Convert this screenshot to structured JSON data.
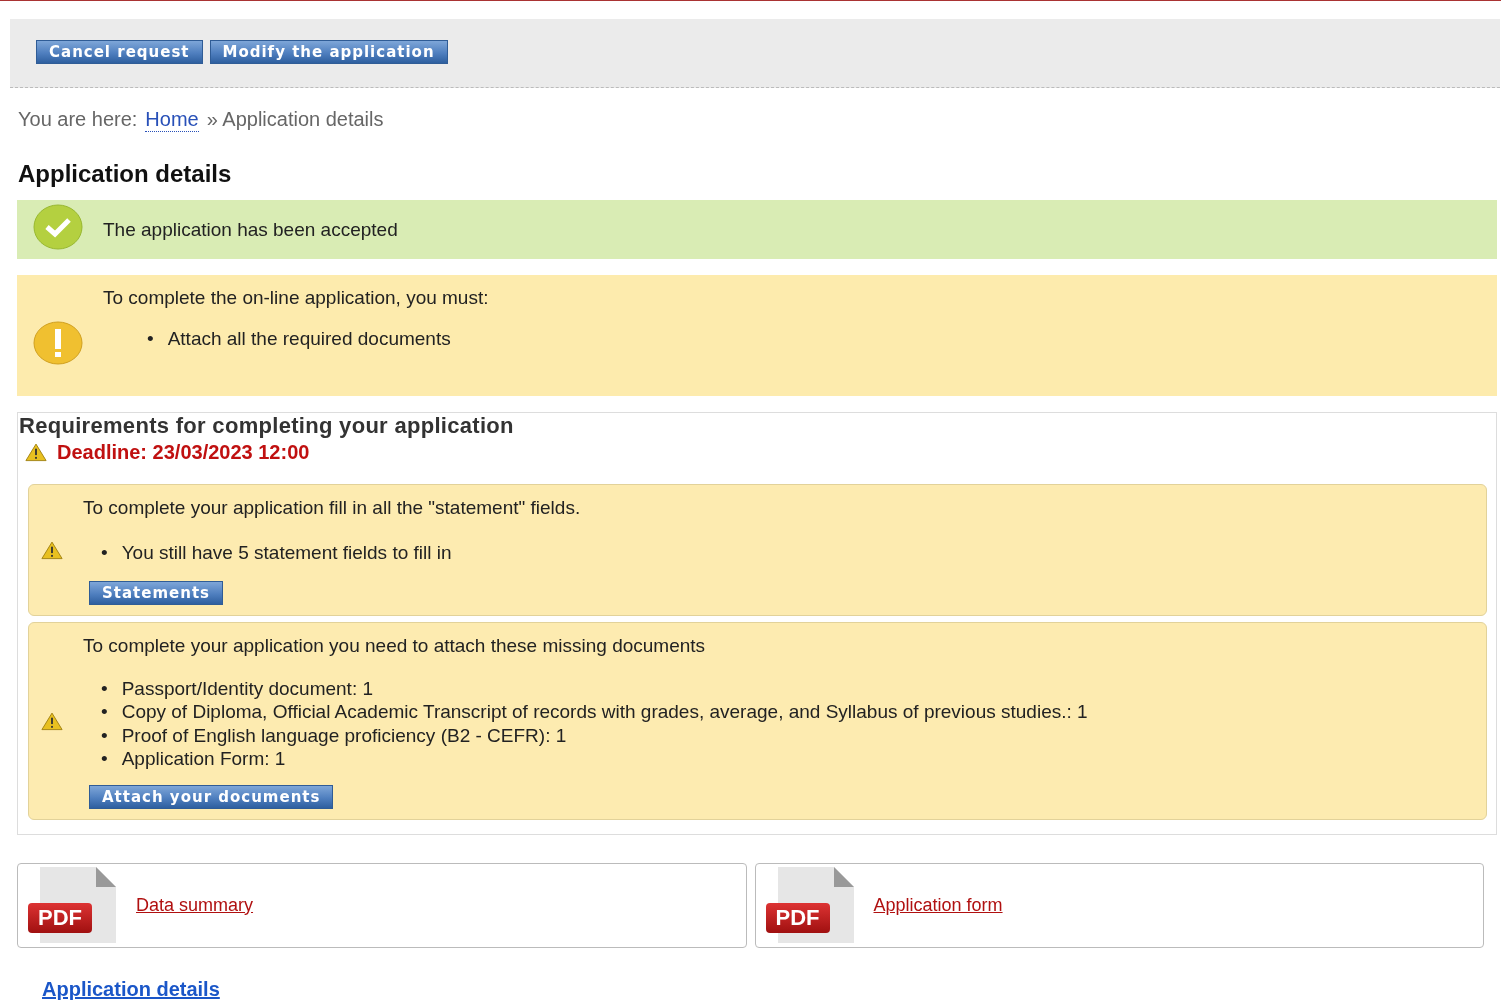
{
  "bullet": "•",
  "toolbar": {
    "buttons": [
      "Cancel request",
      "Modify the application"
    ]
  },
  "breadcrumb": {
    "prefix": "You are here:",
    "links": [
      {
        "label": "Home"
      }
    ],
    "current": "» Application details"
  },
  "title": "Application details",
  "messages": [
    {
      "kind": "success",
      "text": "The application has been accepted"
    },
    {
      "kind": "warning",
      "text": "To complete the on-line application, you must:",
      "items": [
        "Attach all the required documents"
      ]
    }
  ],
  "requirements": {
    "title": "Requirements for completing your application",
    "deadline": "Deadline: 23/03/2023 12:00",
    "panels": [
      {
        "text": "To complete your application fill in all the \"statement\" fields.",
        "items": [
          "You still have 5 statement fields to fill in"
        ],
        "button": "Statements"
      },
      {
        "text": "To complete your application you need to attach these missing documents",
        "items": [
          "Passport/Identity document: 1",
          "Copy of Diploma, Official Academic Transcript of records with grades, average, and Syllabus of previous studies.: 1",
          "Proof of English language proficiency (B2 - CEFR): 1",
          "Application Form: 1"
        ],
        "button": "Attach your documents"
      }
    ]
  },
  "downloads": [
    {
      "badge": "PDF",
      "label": "Data summary"
    },
    {
      "badge": "PDF",
      "label": "Application form"
    }
  ],
  "footer_link": "Application details"
}
